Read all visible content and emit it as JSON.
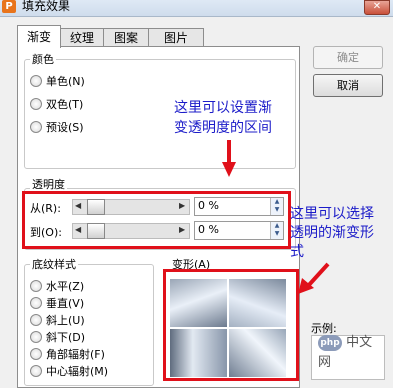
{
  "window": {
    "title": "填充效果",
    "app_icon": "P"
  },
  "tabs": [
    {
      "label": "渐变",
      "active": true
    },
    {
      "label": "纹理",
      "active": false
    },
    {
      "label": "图案",
      "active": false
    },
    {
      "label": "图片",
      "active": false
    }
  ],
  "buttons": {
    "ok": "确定",
    "cancel": "取消"
  },
  "color_group": {
    "legend": "颜色",
    "options": [
      {
        "label": "单色(N)"
      },
      {
        "label": "双色(T)"
      },
      {
        "label": "预设(S)"
      }
    ]
  },
  "transparency": {
    "legend": "透明度",
    "from_label": "从(R):",
    "to_label": "到(O):",
    "from_value": "0 %",
    "to_value": "0 %",
    "from_level": 0,
    "to_level": 0
  },
  "shading": {
    "legend": "底纹样式",
    "options": [
      {
        "label": "水平(Z)"
      },
      {
        "label": "垂直(V)"
      },
      {
        "label": "斜上(U)"
      },
      {
        "label": "斜下(D)"
      },
      {
        "label": "角部辐射(F)"
      },
      {
        "label": "中心辐射(M)"
      }
    ]
  },
  "variants": {
    "legend": "变形(A)"
  },
  "sample": {
    "label": "示例:"
  },
  "annotations": {
    "top_line1": "这里可以设置渐",
    "top_line2": "变透明度的区间",
    "right_line1": "这里可以选择",
    "right_line2": "透明的渐变形",
    "right_line3": "式"
  },
  "watermark": {
    "logo": "php",
    "text": "中文网"
  },
  "colors": {
    "annotation": "#1c1cc9",
    "highlight": "#e0101a"
  }
}
